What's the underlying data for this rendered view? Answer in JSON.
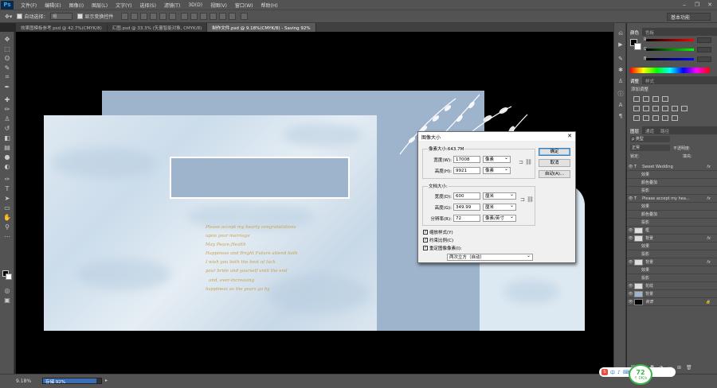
{
  "app": {
    "logo": "Ps"
  },
  "menu": [
    "文件(F)",
    "编辑(E)",
    "图像(I)",
    "图层(L)",
    "文字(Y)",
    "选择(S)",
    "滤镜(T)",
    "3D(D)",
    "视图(V)",
    "窗口(W)",
    "帮助(H)"
  ],
  "window_controls": [
    "‒",
    "❐",
    "✕"
  ],
  "options": {
    "auto_select_label": "自动选择：",
    "auto_select_value": "组",
    "show_transform_label": "显示变换控件",
    "workspace": "基本功能"
  },
  "tabs": [
    {
      "label": "效果图模板参考.psd @ 42.7%(CMYK/8)",
      "active": false
    },
    {
      "label": "汇图.psd @ 33.3% (矢量智能对象, CMYK/8)",
      "active": false
    },
    {
      "label": "制作文件.psd @ 9.18%(CMYK/8) - Saving 92%",
      "active": true
    }
  ],
  "poem": [
    "Please accept my hearty congratulations",
    "upon your marriage",
    "May Peace,Health",
    "Happiness and Bright Future attend both",
    "I wish you both the best of luck",
    "your bride and yourself until the end",
    "and, ever-increasing",
    "happiness as the years go by"
  ],
  "panels": {
    "color_tabs": [
      "颜色",
      "色板"
    ],
    "adjust_tabs": [
      "调整",
      "样式"
    ],
    "adjust_label": "添加调整",
    "layers_tabs": [
      "图层",
      "通道",
      "路径"
    ],
    "kind_label": "ρ 类型",
    "blend_mode": "正常",
    "opacity_label": "不透明度:",
    "lock_label": "锁定:",
    "fill_label": "填充:",
    "rgb": [
      "R",
      "G",
      "B"
    ],
    "layers": [
      {
        "name": "Sweet  Wedding",
        "type": "T",
        "fx": "fx",
        "indent": false
      },
      {
        "name": "效果",
        "type": "",
        "fx": "",
        "indent": true
      },
      {
        "name": "颜色叠加",
        "type": "",
        "fx": "",
        "indent": true
      },
      {
        "name": "投影",
        "type": "",
        "fx": "",
        "indent": true
      },
      {
        "name": "Please accept my hea...",
        "type": "T",
        "fx": "fx",
        "indent": false
      },
      {
        "name": "效果",
        "type": "",
        "fx": "",
        "indent": true
      },
      {
        "name": "颜色叠加",
        "type": "",
        "fx": "",
        "indent": true
      },
      {
        "name": "投影",
        "type": "",
        "fx": "",
        "indent": true
      },
      {
        "name": "框",
        "type": "img",
        "fx": "",
        "indent": false
      },
      {
        "name": "背景",
        "type": "img",
        "fx": "fx",
        "indent": false
      },
      {
        "name": "效果",
        "type": "",
        "fx": "",
        "indent": true
      },
      {
        "name": "投影",
        "type": "",
        "fx": "",
        "indent": true
      },
      {
        "name": "背景",
        "type": "img",
        "fx": "fx",
        "indent": false
      },
      {
        "name": "效果",
        "type": "",
        "fx": "",
        "indent": true
      },
      {
        "name": "投影",
        "type": "",
        "fx": "",
        "indent": true
      },
      {
        "name": "花纹",
        "type": "img",
        "fx": "",
        "indent": false
      },
      {
        "name": "背景",
        "type": "img",
        "fx": "",
        "indent": false
      },
      {
        "name": "背景",
        "type": "img",
        "fx": "",
        "indent": false
      }
    ]
  },
  "status": {
    "zoom": "9.18%",
    "progress_label": "存储 92%",
    "progress": 0.92
  },
  "dialog": {
    "title": "图像大小",
    "close": "✕",
    "pixel_dim_label": "像素大小:643.7M",
    "width_label": "宽度(W):",
    "height_label": "高度(H):",
    "pixel_width": "17008",
    "pixel_height": "9921",
    "pixel_unit": "像素",
    "doc_size_label": "文档大小:",
    "doc_width_label": "宽度(D):",
    "doc_height_label": "高度(G):",
    "resolution_label": "分辨率(R):",
    "doc_width": "600",
    "doc_height": "349.99",
    "resolution": "72",
    "doc_unit": "厘米",
    "res_unit": "像素/英寸",
    "ok": "确定",
    "cancel": "取消",
    "auto": "自动(A)...",
    "scale_styles": "缩放样式(Y)",
    "constrain": "约束比例(C)",
    "resample": "重定图像像素(I):",
    "resample_method": "两次立方（自动）"
  },
  "ime": {
    "items": [
      "中",
      "♪",
      "⌨",
      "简",
      "👕",
      "⚙"
    ],
    "speed": "72",
    "speed_unit": "↑ 0K/s"
  }
}
